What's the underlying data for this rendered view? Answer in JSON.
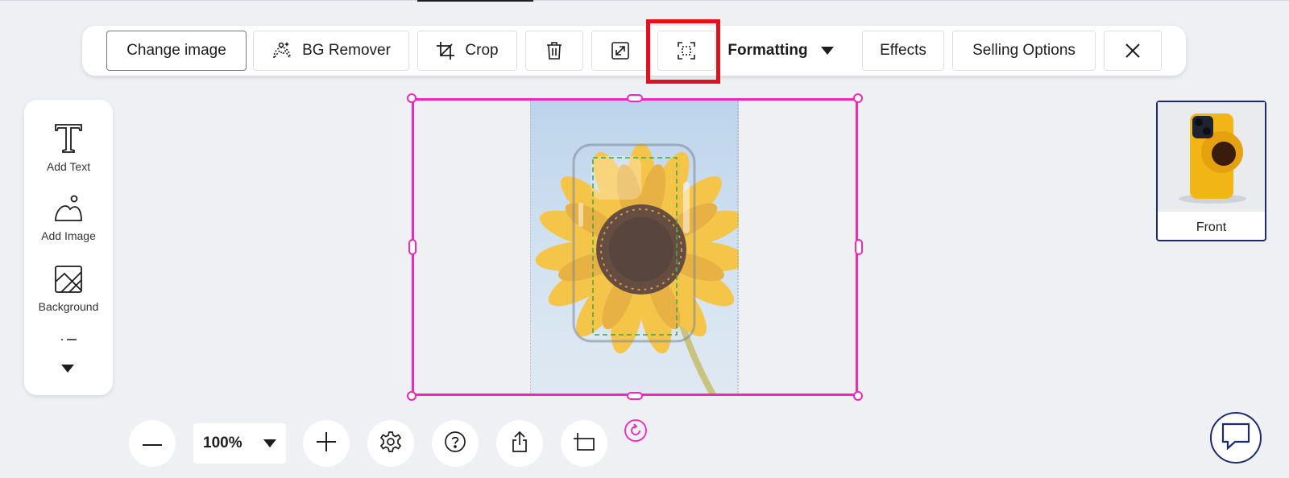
{
  "toolbar": {
    "change_image": "Change image",
    "bg_remover": "BG Remover",
    "crop": "Crop",
    "formatting": "Formatting",
    "effects": "Effects",
    "selling_options": "Selling Options"
  },
  "rail": {
    "add_text": "Add Text",
    "add_image": "Add Image",
    "background": "Background"
  },
  "zoom": {
    "value": "100%"
  },
  "thumbnail": {
    "label": "Front"
  },
  "colors": {
    "selection": "#f226b9",
    "highlight": "#e3101e",
    "accent": "#1e2a6e",
    "safe_area": "#3aa84a"
  },
  "icons": [
    "bg-remover-icon",
    "crop-icon",
    "trash-icon",
    "resize-icon",
    "fit-frame-icon",
    "chevron-down-icon",
    "close-icon",
    "text-icon",
    "image-icon",
    "background-icon",
    "minus-icon",
    "plus-icon",
    "gear-icon",
    "help-icon",
    "share-icon",
    "canvas-icon",
    "rotate-icon",
    "chat-icon"
  ]
}
